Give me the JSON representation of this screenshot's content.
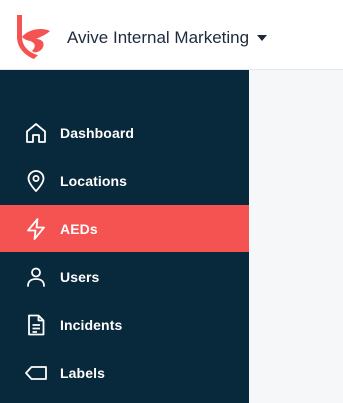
{
  "header": {
    "org_name": "Avive Internal Marketing",
    "logo_icon": "avive-logo-icon",
    "brand_color": "#f45352"
  },
  "sidebar": {
    "active_index": 2,
    "items": [
      {
        "label": "Dashboard",
        "icon": "home-icon"
      },
      {
        "label": "Locations",
        "icon": "location-pin-icon"
      },
      {
        "label": "AEDs",
        "icon": "lightning-icon"
      },
      {
        "label": "Users",
        "icon": "user-icon"
      },
      {
        "label": "Incidents",
        "icon": "document-icon"
      },
      {
        "label": "Labels",
        "icon": "tag-icon"
      }
    ],
    "background": "#08283b",
    "active_color": "#f45352"
  }
}
